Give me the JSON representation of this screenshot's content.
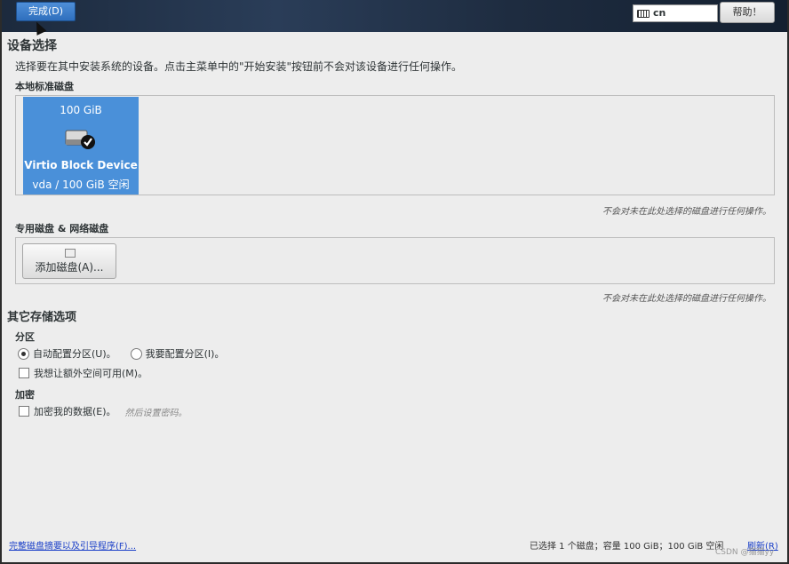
{
  "topbar": {
    "done_label": "完成(D)",
    "keyboard_layout": "cn",
    "help_label": "帮助！"
  },
  "device_selection": {
    "title": "设备选择",
    "description": "选择要在其中安装系统的设备。点击主菜单中的\"开始安装\"按钮前不会对该设备进行任何操作。"
  },
  "local_disks": {
    "label": "本地标准磁盘",
    "disks": [
      {
        "size": "100 GiB",
        "name": "Virtio Block Device",
        "detail": "vda / 100 GiB 空闲",
        "selected": true,
        "icon": "hard-disk-checked-icon"
      }
    ],
    "note": "不会对未在此处选择的磁盘进行任何操作。"
  },
  "special_disks": {
    "label": "专用磁盘 & 网络磁盘",
    "add_button": "添加磁盘(A)...",
    "note": "不会对未在此处选择的磁盘进行任何操作。"
  },
  "other_storage": {
    "title": "其它存储选项",
    "partition": {
      "label": "分区",
      "auto_option": "自动配置分区(U)。",
      "manual_option": "我要配置分区(I)。",
      "selected": "auto",
      "extra_space_option": "我想让额外空间可用(M)。",
      "extra_space_checked": false
    },
    "encryption": {
      "label": "加密",
      "encrypt_option": "加密我的数据(E)。",
      "encrypt_hint": "然后设置密码。",
      "encrypt_checked": false
    }
  },
  "footer": {
    "summary_link": "完整磁盘摘要以及引导程序(F)...",
    "status": "已选择 1 个磁盘；容量 100 GiB；100 GiB 空闲",
    "refresh_link": "刷新(R)",
    "watermark": "CSDN @猫猫yy"
  },
  "colors": {
    "selected_tile": "#4a90d9",
    "done_button": "#3a7bc8",
    "link": "#1a3fc8"
  }
}
